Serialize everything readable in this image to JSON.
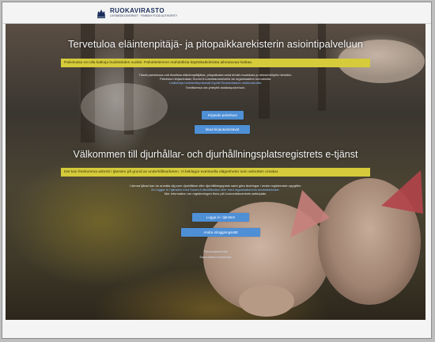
{
  "header": {
    "logo_name": "RUOKAVIRASTO",
    "logo_sub": "LIVSMEDELSVERKET · FINNISH FOOD AUTHORITY"
  },
  "fi": {
    "title": "Tervetuloa eläintenpitäjä- ja pitopaikkarekisterin asiointipalveluun",
    "notice": "Palvelussa voi olla katkoja huoltotöiden vuoksi. Pahoittelemme mahdollisia käyttökatkoksista aiheutuvaa haittaa.",
    "para": [
      "Tässä palvelussa voit ilmoittaa eläintenpitäjäksi, pitopaikaksi sekä tehdä muutoksia jo rekisteröityihin tietoihin.",
      "Palveluun kirjaudutaan Suomi.fi-tunnistautumisella tai organisaation tunnuksilla.",
      "Lisätietoja rekisteröitymisestä löydät Ruokaviraston verkkosivuilta.",
      "Tarvittaessa ota yhteyttä asiakaspalveluun."
    ],
    "btn_login": "Kirjaudu palveluun",
    "btn_other": "Muut kirjautumistavat"
  },
  "sv": {
    "title": "Välkommen till djurhållar- och djurhållningsplatsregistrets e-tjänst",
    "notice": "Det kan förekomma avbrott i tjänsten på grund av underhållsarbeten. Vi beklagar eventuella olägenheter som avbrotten orsakar.",
    "para": [
      "I denna tjänst kan du anmäla dig som djurhållare eller djurhållningsplats samt göra ändringar i redan registrerade uppgifter.",
      "Du loggar in i tjänsten med Suomi.fi-identifikation eller med organisationens användarkoder.",
      "Mer information om registreringen finns på Livsmedelsverkets webbplats."
    ],
    "btn_login": "Logga in i tjänsten",
    "btn_other": "Andra inloggningssätt"
  },
  "footer": {
    "line1": "Tietosuojaseloste",
    "line2": "Saavutettavuusseloste"
  }
}
